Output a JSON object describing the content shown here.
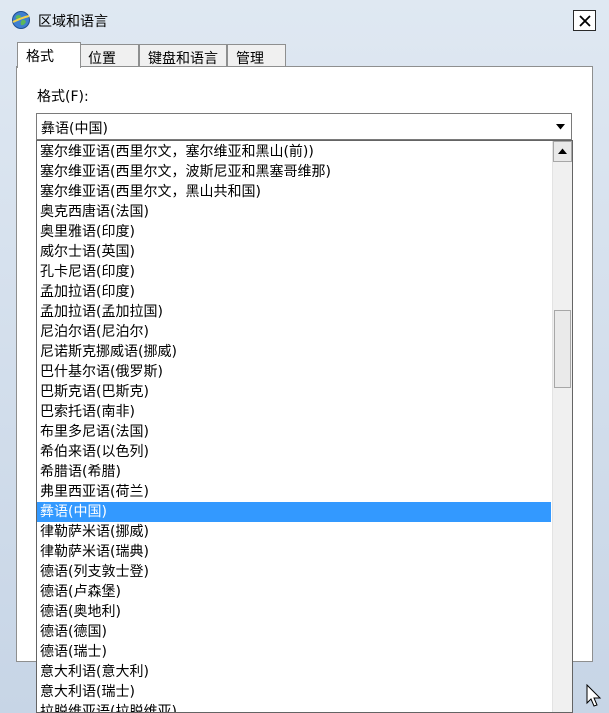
{
  "window": {
    "title": "区域和语言"
  },
  "tabs": [
    {
      "label": "格式"
    },
    {
      "label": "位置"
    },
    {
      "label": "键盘和语言"
    },
    {
      "label": "管理"
    }
  ],
  "format": {
    "label": "格式(F):",
    "selected": "彝语(中国)"
  },
  "dropdown": {
    "items": [
      "塞尔维亚语(西里尔文，塞尔维亚和黑山(前))",
      "塞尔维亚语(西里尔文，波斯尼亚和黑塞哥维那)",
      "塞尔维亚语(西里尔文，黑山共和国)",
      "奥克西唐语(法国)",
      "奥里雅语(印度)",
      "威尔士语(英国)",
      "孔卡尼语(印度)",
      "孟加拉语(印度)",
      "孟加拉语(孟加拉国)",
      "尼泊尔语(尼泊尔)",
      "尼诺斯克挪威语(挪威)",
      "巴什基尔语(俄罗斯)",
      "巴斯克语(巴斯克)",
      "巴索托语(南非)",
      "布里多尼语(法国)",
      "希伯来语(以色列)",
      "希腊语(希腊)",
      "弗里西亚语(荷兰)",
      "彝语(中国)",
      "律勒萨米语(挪威)",
      "律勒萨米语(瑞典)",
      "德语(列支敦士登)",
      "德语(卢森堡)",
      "德语(奥地利)",
      "德语(德国)",
      "德语(瑞士)",
      "意大利语(意大利)",
      "意大利语(瑞士)",
      "拉脱维亚语(拉脱维亚)"
    ],
    "selected_index": 18
  },
  "colors": {
    "selection": "#3399ff",
    "chrome": "#cdd9e6"
  }
}
